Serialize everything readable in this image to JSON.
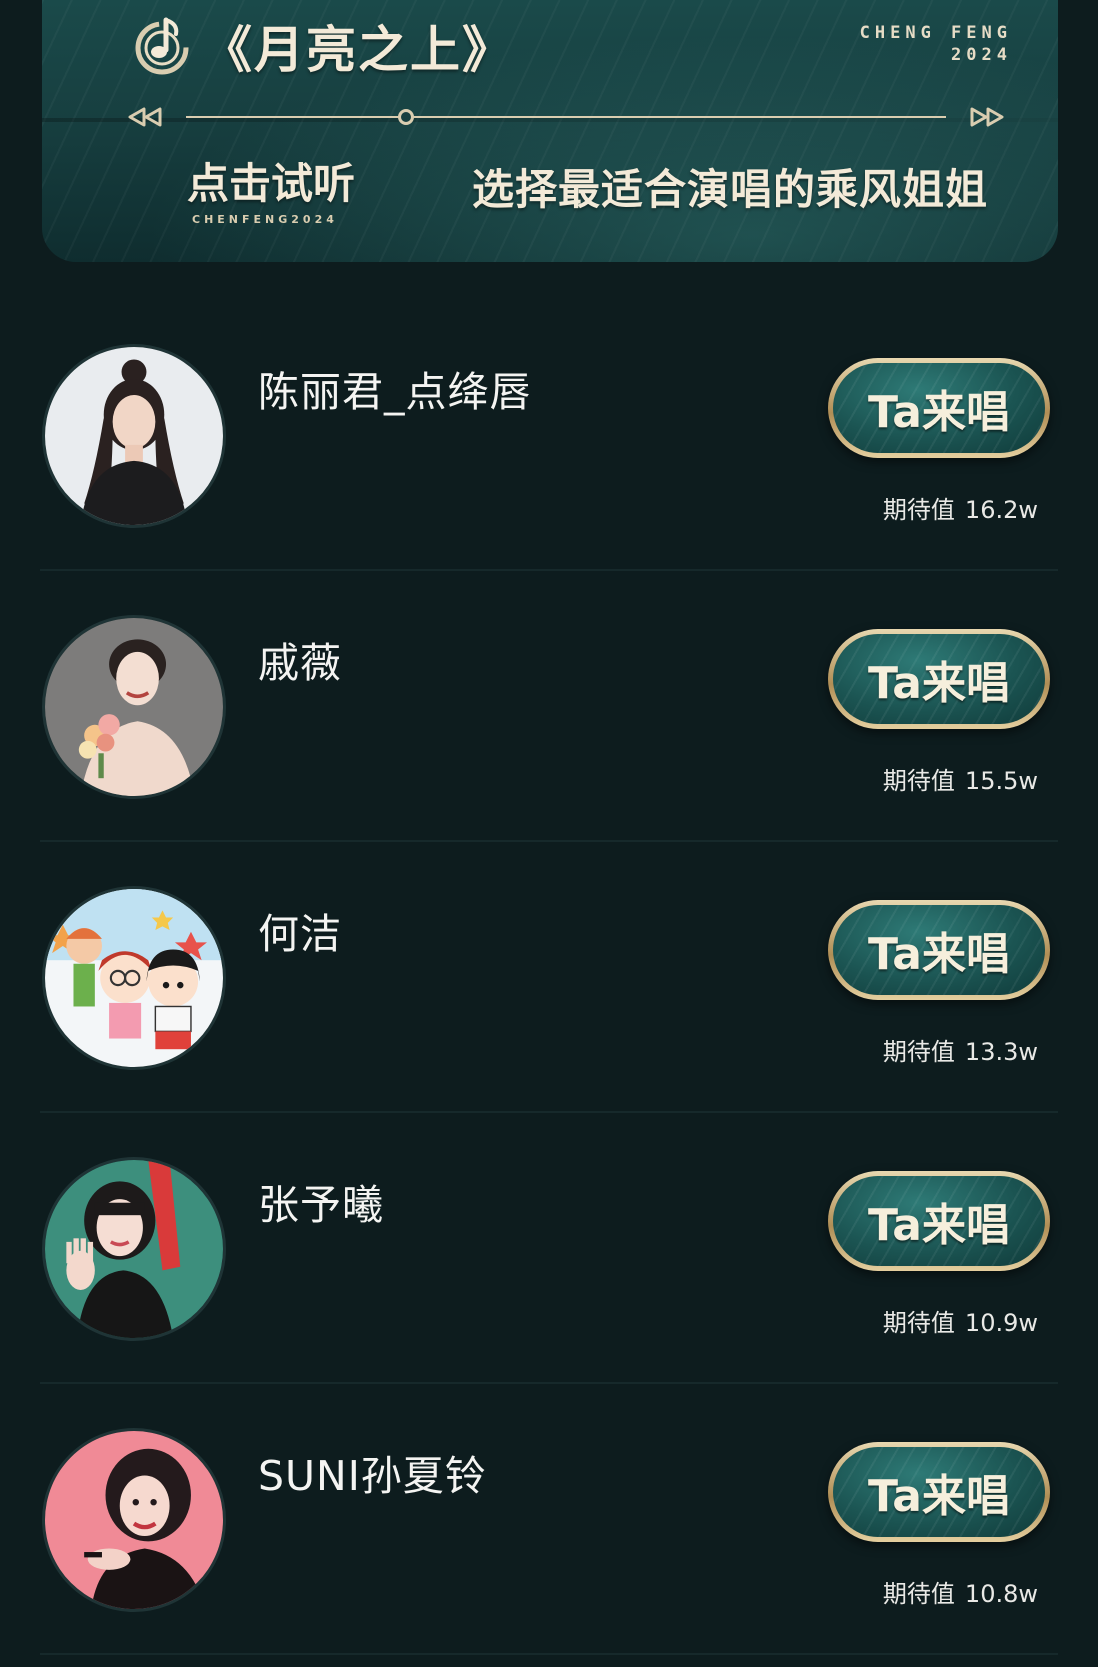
{
  "banner": {
    "song_title": "《月亮之上》",
    "brand_line1": "CHENG FENG",
    "brand_line2": "2024",
    "listen_label": "点击试听",
    "listen_sub": "CHENFENG2024",
    "choose_label": "选择最适合演唱的乘风姐姐",
    "progress": 0.29
  },
  "colors": {
    "background": "#0d1c1e",
    "banner": "#173f40",
    "gold": "#d9cdb0",
    "button_teal": "#1b5452"
  },
  "candidates": [
    {
      "name": "陈丽君_点绛唇",
      "button_label": "Ta来唱",
      "expect_label": "期待值",
      "expect_value": "16.2w",
      "avatar_icon": "woman-portrait-bun"
    },
    {
      "name": "戚薇",
      "button_label": "Ta来唱",
      "expect_label": "期待值",
      "expect_value": "15.5w",
      "avatar_icon": "woman-portrait-flowers"
    },
    {
      "name": "何洁",
      "button_label": "Ta来唱",
      "expect_label": "期待值",
      "expect_value": "13.3w",
      "avatar_icon": "cartoon-children"
    },
    {
      "name": "张予曦",
      "button_label": "Ta来唱",
      "expect_label": "期待值",
      "expect_value": "10.9w",
      "avatar_icon": "woman-portrait-wave"
    },
    {
      "name": "SUNI孙夏铃",
      "button_label": "Ta来唱",
      "expect_label": "期待值",
      "expect_value": "10.8w",
      "avatar_icon": "woman-portrait-pink"
    }
  ]
}
